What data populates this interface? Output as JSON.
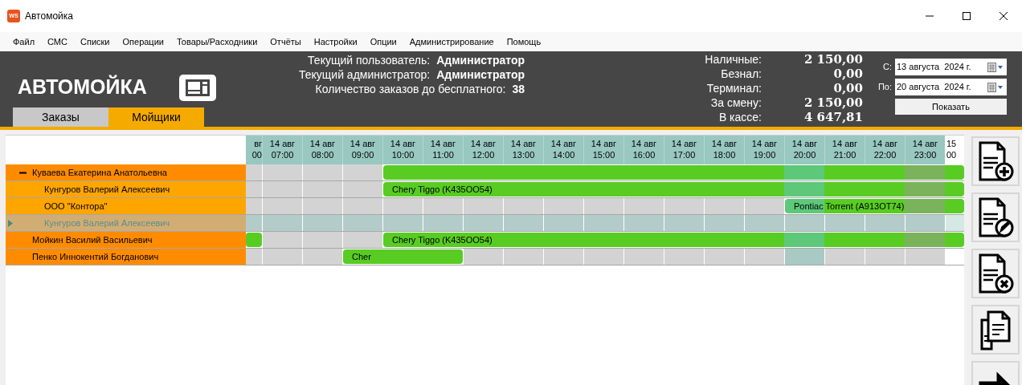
{
  "window": {
    "title": "Автомойка",
    "logo": "WS"
  },
  "menu": [
    "Файл",
    "СМС",
    "Списки",
    "Операции",
    "Товары/Расходники",
    "Отчёты",
    "Настройки",
    "Опции",
    "Администрирование",
    "Помощь"
  ],
  "header": {
    "app_title": "АВТОМОЙКА",
    "info": [
      {
        "label": "Текущий пользователь:",
        "value": "Администратор"
      },
      {
        "label": "Текущий администратор:",
        "value": "Администратор"
      },
      {
        "label": "Количество заказов до бесплатного:",
        "value": "38"
      }
    ],
    "totals": [
      {
        "label": "Наличные:",
        "value": "2 150,00"
      },
      {
        "label": "Безнал:",
        "value": "0,00"
      },
      {
        "label": "Терминал:",
        "value": "0,00"
      },
      {
        "label": "За смену:",
        "value": "2 150,00"
      },
      {
        "label": "В кассе:",
        "value": "4 647,81"
      }
    ],
    "date_from": {
      "label": "С:",
      "value": "13 августа  2024 г."
    },
    "date_to": {
      "label": "По:",
      "value": "20 августа  2024 г."
    },
    "show_button": "Показать"
  },
  "tabs": [
    {
      "label": "Заказы",
      "selected": false
    },
    {
      "label": "Мойщики",
      "selected": true
    }
  ],
  "schedule": {
    "columns": [
      {
        "day": "вг",
        "time": "00",
        "kind": "cut"
      },
      {
        "day": "14 авг",
        "time": "07:00",
        "kind": "hour"
      },
      {
        "day": "14 авг",
        "time": "08:00",
        "kind": "hour"
      },
      {
        "day": "14 авг",
        "time": "09:00",
        "kind": "hour"
      },
      {
        "day": "14 авг",
        "time": "10:00",
        "kind": "hour"
      },
      {
        "day": "14 авг",
        "time": "11:00",
        "kind": "hour"
      },
      {
        "day": "14 авг",
        "time": "12:00",
        "kind": "hour"
      },
      {
        "day": "14 авг",
        "time": "13:00",
        "kind": "hour"
      },
      {
        "day": "14 авг",
        "time": "14:00",
        "kind": "hour"
      },
      {
        "day": "14 авг",
        "time": "15:00",
        "kind": "hour"
      },
      {
        "day": "14 авг",
        "time": "16:00",
        "kind": "hour"
      },
      {
        "day": "14 авг",
        "time": "17:00",
        "kind": "hour"
      },
      {
        "day": "14 авг",
        "time": "18:00",
        "kind": "hour"
      },
      {
        "day": "14 авг",
        "time": "19:00",
        "kind": "hour"
      },
      {
        "day": "14 авг",
        "time": "20:00",
        "kind": "current"
      },
      {
        "day": "14 авг",
        "time": "21:00",
        "kind": "hour"
      },
      {
        "day": "14 авг",
        "time": "22:00",
        "kind": "hour"
      },
      {
        "day": "14 авг",
        "time": "23:00",
        "kind": "dim"
      },
      {
        "day": "15",
        "time": "00",
        "kind": "next_day"
      }
    ],
    "rows": [
      {
        "name": "Куваева Екатерина Анатольевна",
        "expanded": true,
        "selected": false,
        "slots": [
          {
            "booked": false
          },
          {
            "booked": false
          },
          {
            "booked": false
          },
          {
            "booked": false
          },
          {
            "booked": true
          },
          {
            "booked": true
          },
          {
            "booked": true
          },
          {
            "booked": true
          },
          {
            "booked": true
          },
          {
            "booked": true
          },
          {
            "booked": true
          },
          {
            "booked": true
          },
          {
            "booked": true
          },
          {
            "booked": true
          },
          {
            "booked": true
          },
          {
            "booked": true
          },
          {
            "booked": true
          },
          {
            "booked": true
          },
          {
            "booked": true
          }
        ],
        "children": [
          {
            "name": "Кунгуров Валерий Алексеевич",
            "selected": false,
            "slots": [
              {
                "booked": false
              },
              {
                "booked": false
              },
              {
                "booked": false
              },
              {
                "booked": false
              },
              {
                "booked": true,
                "label": "Chery Tiggo (K435OO54)"
              },
              {
                "booked": true
              },
              {
                "booked": true
              },
              {
                "booked": true
              },
              {
                "booked": true
              },
              {
                "booked": true
              },
              {
                "booked": true
              },
              {
                "booked": true
              },
              {
                "booked": true
              },
              {
                "booked": true
              },
              {
                "booked": true
              },
              {
                "booked": true
              },
              {
                "booked": true
              },
              {
                "booked": true
              },
              {
                "booked": true
              }
            ]
          },
          {
            "name": "ООО \"Контора\"",
            "selected": false,
            "slots": [
              {
                "booked": false
              },
              {
                "booked": false
              },
              {
                "booked": false
              },
              {
                "booked": false
              },
              {
                "booked": false
              },
              {
                "booked": false
              },
              {
                "booked": false
              },
              {
                "booked": false
              },
              {
                "booked": false
              },
              {
                "booked": false
              },
              {
                "booked": false
              },
              {
                "booked": false
              },
              {
                "booked": false
              },
              {
                "booked": false
              },
              {
                "booked": true,
                "label": "Pontiac Torrent (A913OT74)"
              },
              {
                "booked": true
              },
              {
                "booked": true
              },
              {
                "booked": true
              },
              {
                "booked": true
              }
            ]
          },
          {
            "name": "Кунгуров Валерий Алексеевич",
            "selected": true,
            "slots": [
              {
                "booked": false
              },
              {
                "booked": false
              },
              {
                "booked": false
              },
              {
                "booked": false
              },
              {
                "booked": false
              },
              {
                "booked": false
              },
              {
                "booked": false
              },
              {
                "booked": false
              },
              {
                "booked": false
              },
              {
                "booked": false
              },
              {
                "booked": false
              },
              {
                "booked": false
              },
              {
                "booked": false
              },
              {
                "booked": false
              },
              {
                "booked": false
              },
              {
                "booked": false
              },
              {
                "booked": false
              },
              {
                "booked": false
              },
              {
                "booked": false
              }
            ]
          }
        ]
      },
      {
        "name": "Мойкин Василий Васильевич",
        "selected": false,
        "slots": [
          {
            "booked": true
          },
          {
            "booked": false
          },
          {
            "booked": false
          },
          {
            "booked": false
          },
          {
            "booked": true,
            "label": "Chery Tiggo (K435OO54)"
          },
          {
            "booked": true
          },
          {
            "booked": true
          },
          {
            "booked": true
          },
          {
            "booked": true
          },
          {
            "booked": true
          },
          {
            "booked": true
          },
          {
            "booked": true
          },
          {
            "booked": true
          },
          {
            "booked": true
          },
          {
            "booked": true
          },
          {
            "booked": true
          },
          {
            "booked": true
          },
          {
            "booked": true
          },
          {
            "booked": true
          }
        ]
      },
      {
        "name": "Пенко Иннокентий Богданович",
        "selected": false,
        "slots": [
          {
            "booked": false
          },
          {
            "booked": false
          },
          {
            "booked": false
          },
          {
            "booked": true,
            "label": "Cher"
          },
          {
            "booked": true
          },
          {
            "booked": true
          },
          {
            "booked": false
          },
          {
            "booked": false
          },
          {
            "booked": false
          },
          {
            "booked": false
          },
          {
            "booked": false
          },
          {
            "booked": false
          },
          {
            "booked": false
          },
          {
            "booked": false
          },
          {
            "booked": false
          },
          {
            "booked": false
          },
          {
            "booked": false
          },
          {
            "booked": false
          },
          {
            "booked": false
          }
        ]
      }
    ]
  }
}
